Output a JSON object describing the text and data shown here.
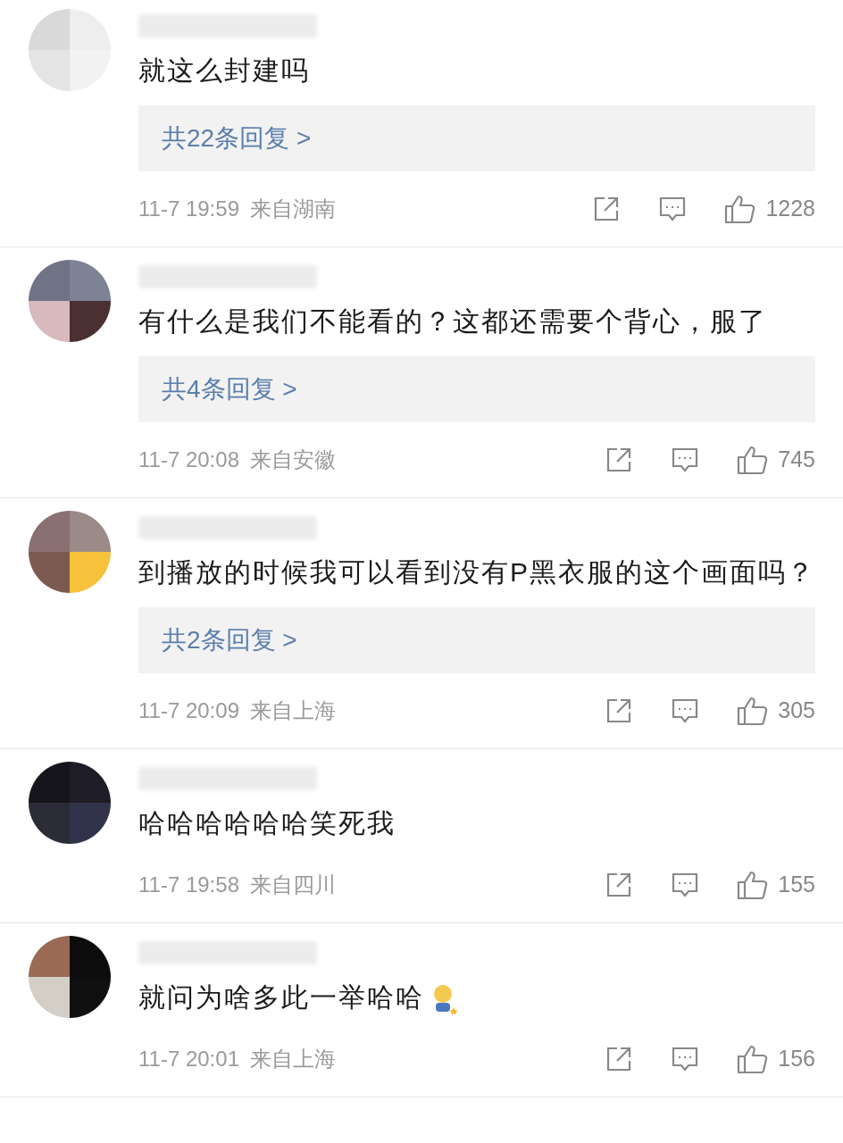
{
  "comments": [
    {
      "text": "就这么封建吗",
      "replies": "共22条回复 >",
      "time": "11-7 19:59",
      "location": "来自湖南",
      "likes": "1228",
      "emoji": false
    },
    {
      "text": "有什么是我们不能看的？这都还需要个背心，服了",
      "replies": "共4条回复 >",
      "time": "11-7 20:08",
      "location": "来自安徽",
      "likes": "745",
      "emoji": false
    },
    {
      "text": "到播放的时候我可以看到没有P黑衣服的这个画面吗？",
      "replies": "共2条回复 >",
      "time": "11-7 20:09",
      "location": "来自上海",
      "likes": "305",
      "emoji": false
    },
    {
      "text": "哈哈哈哈哈哈笑死我",
      "time": "11-7 19:58",
      "location": "来自四川",
      "likes": "155",
      "emoji": false
    },
    {
      "text": "就问为啥多此一举哈哈",
      "time": "11-7 20:01",
      "location": "来自上海",
      "likes": "156",
      "emoji": true
    }
  ]
}
